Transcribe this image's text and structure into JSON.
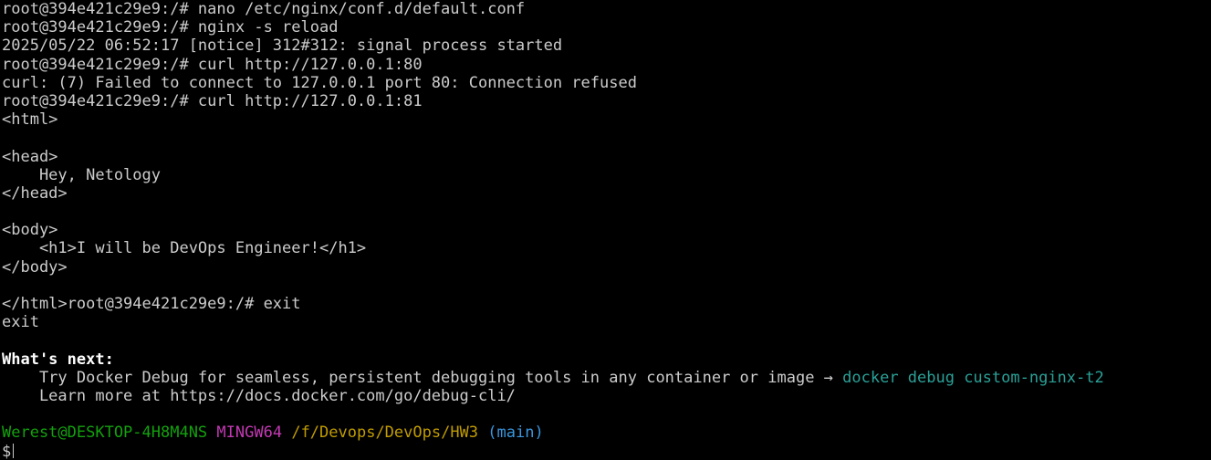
{
  "terminal": {
    "lines": [
      "root@394e421c29e9:/# nano /etc/nginx/conf.d/default.conf",
      "root@394e421c29e9:/# nginx -s reload",
      "2025/05/22 06:52:17 [notice] 312#312: signal process started",
      "root@394e421c29e9:/# curl http://127.0.0.1:80",
      "curl: (7) Failed to connect to 127.0.0.1 port 80: Connection refused",
      "root@394e421c29e9:/# curl http://127.0.0.1:81",
      "<html>",
      "",
      "<head>",
      "    Hey, Netology",
      "</head>",
      "",
      "<body>",
      "    <h1>I will be DevOps Engineer!</h1>",
      "</body>",
      "",
      "</html>root@394e421c29e9:/# exit",
      "exit",
      ""
    ],
    "whats_next_heading": "What's next:",
    "tip_text": "    Try Docker Debug for seamless, persistent debugging tools in any container or image → ",
    "tip_command": "docker debug custom-nginx-t2",
    "learn_more": "    Learn more at https://docs.docker.com/go/debug-cli/",
    "prompt_user": "Werest@DESKTOP-4H8M4NS",
    "prompt_system": "MINGW64",
    "prompt_path": "/f/Devops/DevOps/HW3",
    "prompt_branch": "(main)",
    "prompt_symbol": "$"
  },
  "colors": {
    "background": "#000000",
    "text": "#cccccc",
    "user": "#13a10e",
    "system": "#c239b3",
    "path": "#c19c00",
    "branch": "#3a96dd",
    "command_highlight": "#2aa198"
  }
}
